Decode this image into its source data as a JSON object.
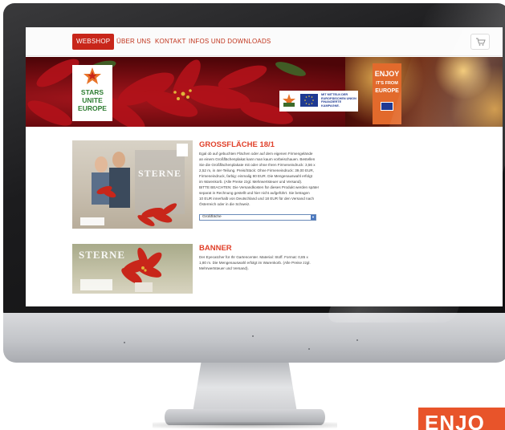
{
  "nav": {
    "items": [
      "WEBSHOP",
      "ÜBER UNS",
      "KONTAKT",
      "INFOS UND DOWNLOADS"
    ],
    "active_index": 0,
    "cart_icon": "cart-icon"
  },
  "hero": {
    "logo_lines": [
      "STARS",
      "UNITE",
      "EUROPE"
    ],
    "eu_text": [
      "MIT MITTELN DER",
      "EUROPÄISCHEN UNION",
      "FINANZIERTE KAMPAGNE."
    ],
    "enjoy_lines": [
      "ENJOY",
      "IT'S FROM",
      "EUROPE"
    ]
  },
  "products": [
    {
      "title": "GROSSFLÄCHE 18/1",
      "image_text": "STERNE",
      "description": [
        "Egal ob auf gebuchten Flächen oder auf dem eigenen Firmengelände",
        "an einem Großflächenplakat kann man kaum vorbeischauen. Bestellen",
        "Sie die Großflächenplakate mit oder ohne Ihren Firmeneindruck: 3,56 x",
        "2,52 m, in 4er-Teilung. Preis/Stück: Ohne Firmeneindruck: 39,00 EUR,",
        "Firmeneindruck, farbig: einmalig 80 EUR. Die Mengenauswahl erfolgt",
        "im Warenkorb. (Alle Preise zzgl. Mehrwertsteuer und Versand).",
        "BITTE BEACHTEN: Die Versandkosten für dieses Produkt werden später",
        "separat in Rechnung gestellt und hier nicht aufgeführt. Sie betragen",
        "10 EUR innerhalb von Deutschland und 18 EUR für den Versand nach",
        "Österreich oder in die Schweiz."
      ],
      "select_value": "Großfläche"
    },
    {
      "title": "BANNER",
      "image_text": "STERNE",
      "description": [
        "Der Eyecatcher für Ihr Gartencenter. Material: Stoff. Format: 0,85 x",
        "1,80 m. Die Mengenauswahl erfolgt im Warenkorb. (Alle Preise zzgl.",
        "Mehrwertsteuer und Versand)."
      ]
    }
  ],
  "badge": {
    "text": "ENJO"
  },
  "colors": {
    "brand_red": "#c8261a",
    "title_orange": "#e0402a",
    "enjoy_orange": "#e26a2c",
    "eu_blue": "#1f3a93"
  }
}
